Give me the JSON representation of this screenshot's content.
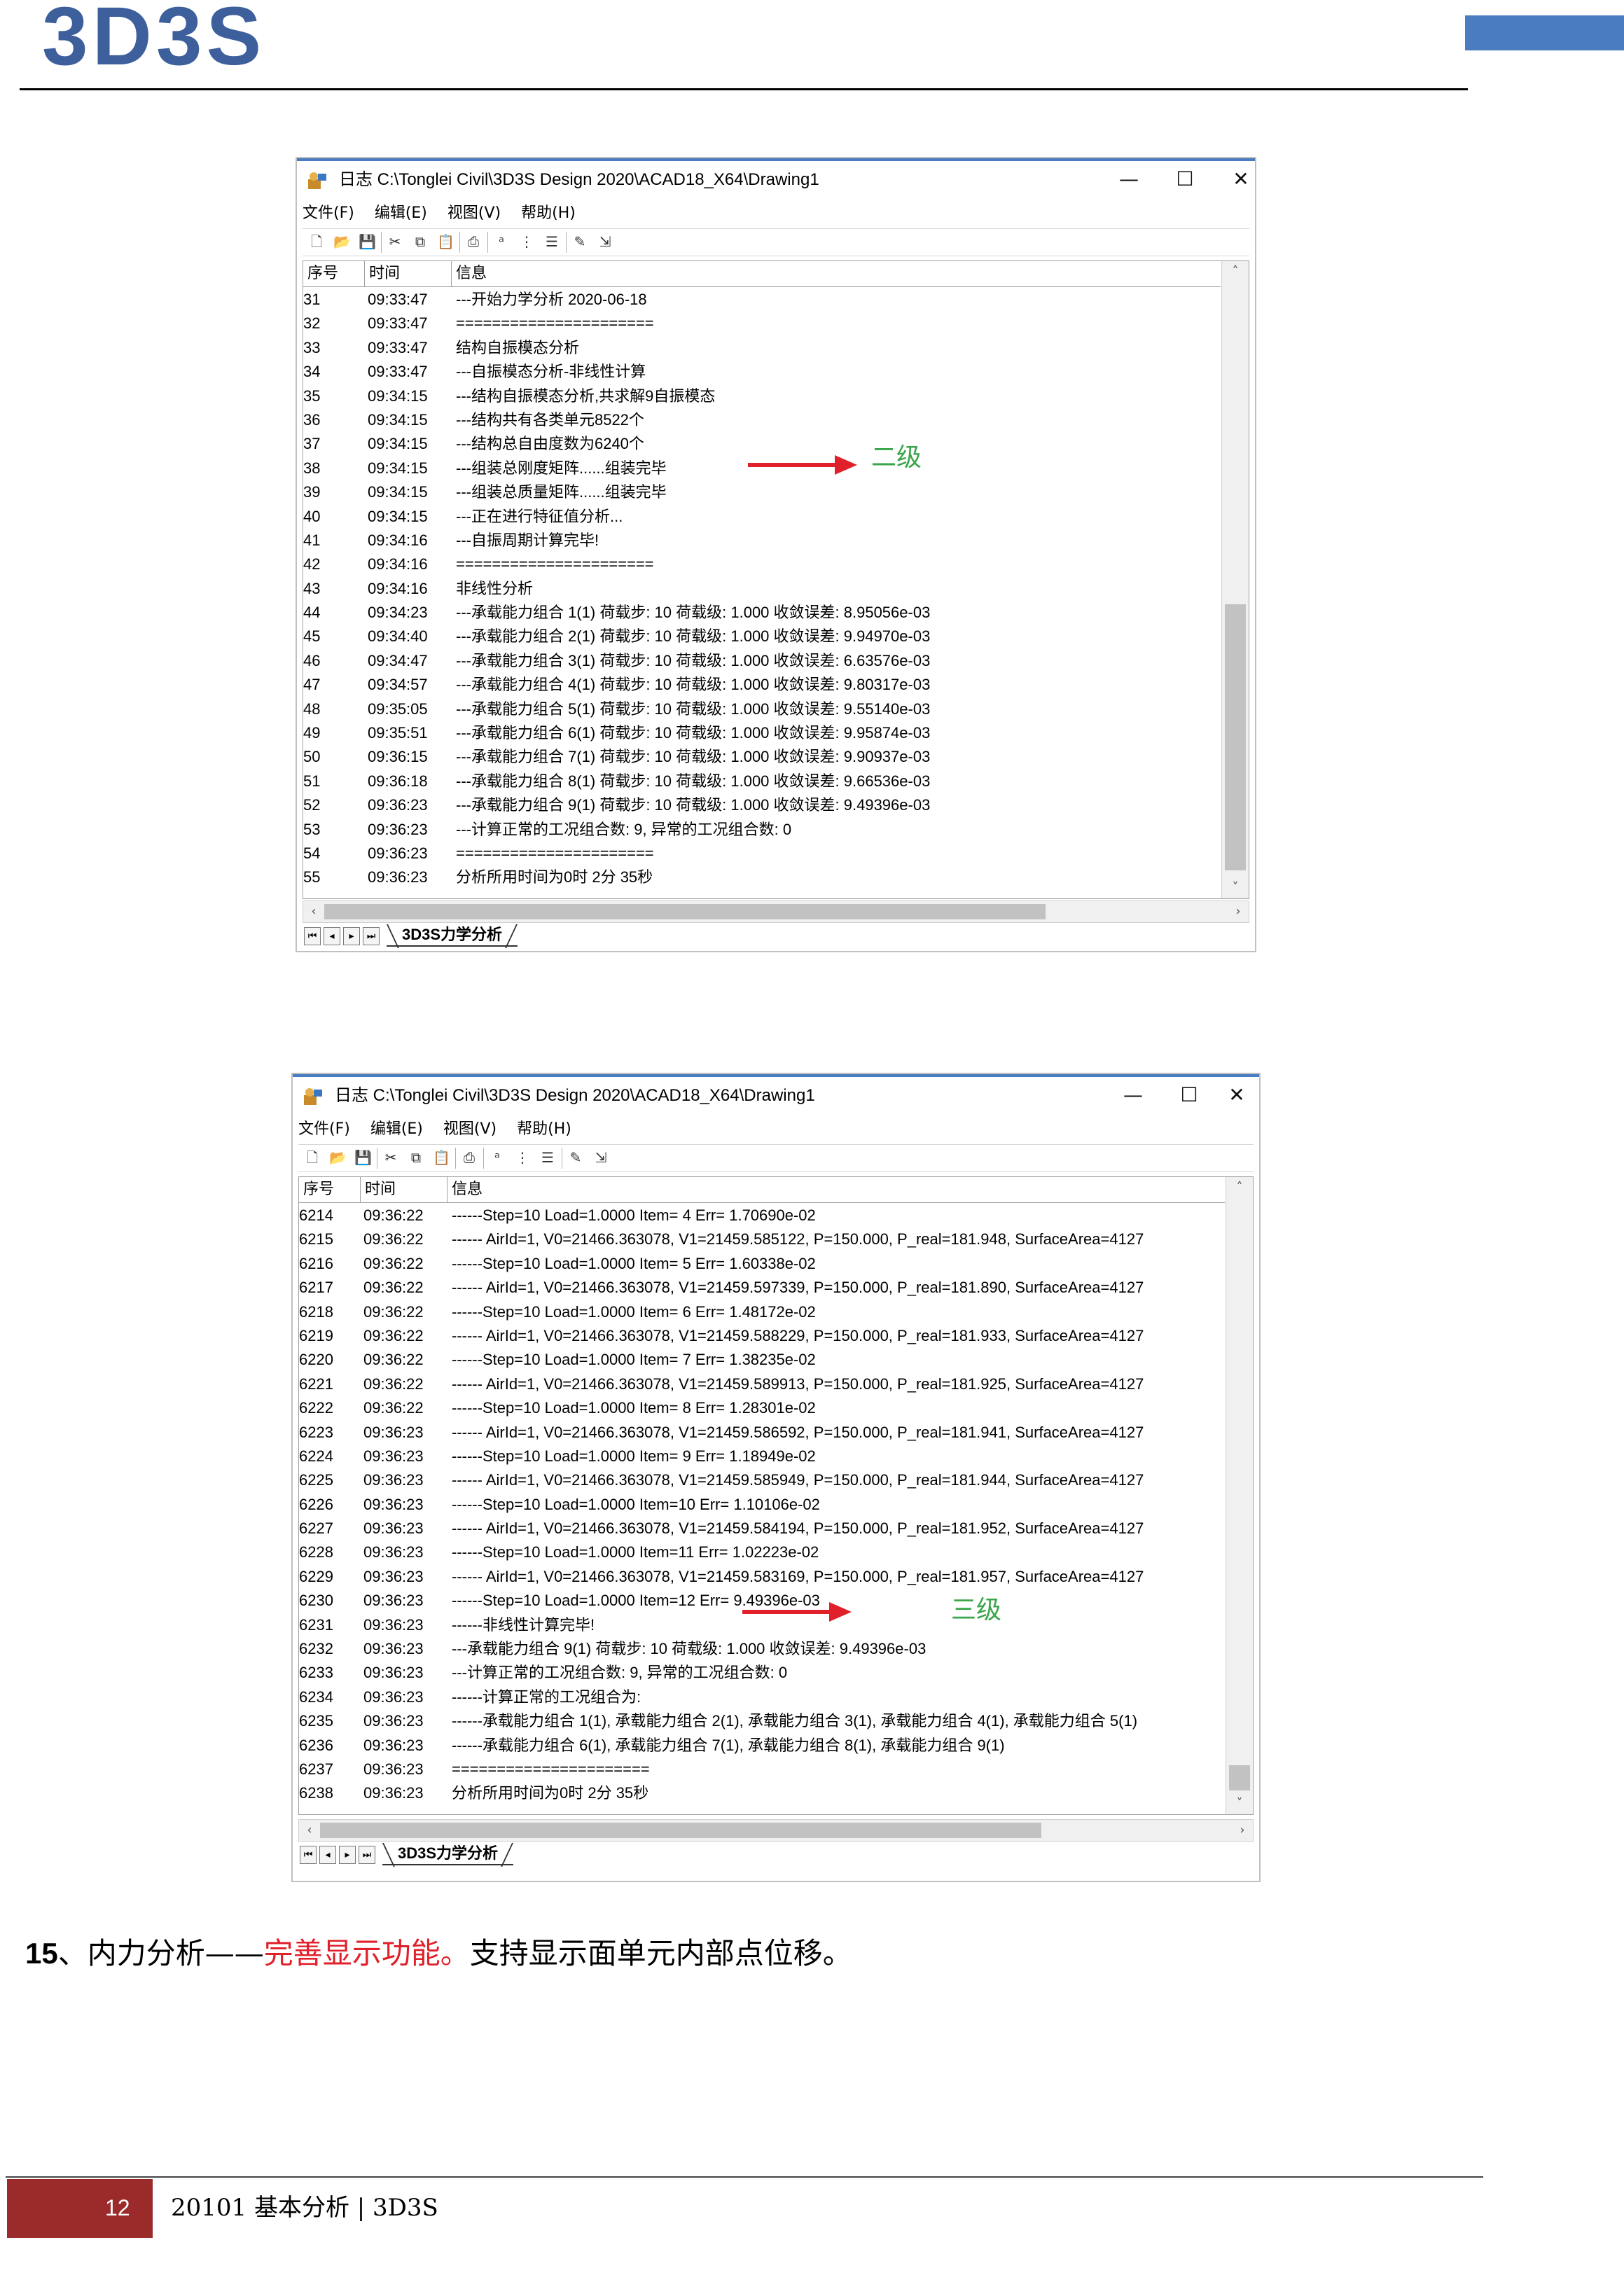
{
  "header": {
    "logo_text": "3D3S"
  },
  "windows": [
    {
      "title": "日志  C:\\Tonglei Civil\\3D3S Design 2020\\ACAD18_X64\\Drawing1",
      "menu": [
        "文件(F)",
        "编辑(E)",
        "视图(V)",
        "帮助(H)"
      ],
      "columns": [
        "序号",
        "时间",
        "信息"
      ],
      "rows": [
        {
          "n": "31",
          "t": "09:33:47",
          "m": "---开始力学分析    2020-06-18"
        },
        {
          "n": "32",
          "t": "09:33:47",
          "m": "======================"
        },
        {
          "n": "33",
          "t": "09:33:47",
          "m": "结构自振模态分析"
        },
        {
          "n": "34",
          "t": "09:33:47",
          "m": "---自振模态分析-非线性计算"
        },
        {
          "n": "35",
          "t": "09:34:15",
          "m": "---结构自振模态分析,共求解9自振模态"
        },
        {
          "n": "36",
          "t": "09:34:15",
          "m": "---结构共有各类单元8522个"
        },
        {
          "n": "37",
          "t": "09:34:15",
          "m": "---结构总自由度数为6240个"
        },
        {
          "n": "38",
          "t": "09:34:15",
          "m": "---组装总刚度矩阵......组装完毕"
        },
        {
          "n": "39",
          "t": "09:34:15",
          "m": "---组装总质量矩阵......组装完毕"
        },
        {
          "n": "40",
          "t": "09:34:15",
          "m": "---正在进行特征值分析..."
        },
        {
          "n": "41",
          "t": "09:34:16",
          "m": "---自振周期计算完毕!"
        },
        {
          "n": "42",
          "t": "09:34:16",
          "m": "======================"
        },
        {
          "n": "43",
          "t": "09:34:16",
          "m": "非线性分析"
        },
        {
          "n": "44",
          "t": "09:34:23",
          "m": "---承载能力组合 1(1)    荷载步: 10  荷载级: 1.000  收敛误差:  8.95056e-03"
        },
        {
          "n": "45",
          "t": "09:34:40",
          "m": "---承载能力组合 2(1)    荷载步: 10  荷载级: 1.000  收敛误差:  9.94970e-03"
        },
        {
          "n": "46",
          "t": "09:34:47",
          "m": "---承载能力组合 3(1)    荷载步: 10  荷载级: 1.000  收敛误差:  6.63576e-03"
        },
        {
          "n": "47",
          "t": "09:34:57",
          "m": "---承载能力组合 4(1)    荷载步: 10  荷载级: 1.000  收敛误差:  9.80317e-03"
        },
        {
          "n": "48",
          "t": "09:35:05",
          "m": "---承载能力组合 5(1)    荷载步: 10  荷载级: 1.000  收敛误差:  9.55140e-03"
        },
        {
          "n": "49",
          "t": "09:35:51",
          "m": "---承载能力组合 6(1)    荷载步: 10  荷载级: 1.000  收敛误差:  9.95874e-03"
        },
        {
          "n": "50",
          "t": "09:36:15",
          "m": "---承载能力组合 7(1)    荷载步: 10  荷载级: 1.000  收敛误差:  9.90937e-03"
        },
        {
          "n": "51",
          "t": "09:36:18",
          "m": "---承载能力组合 8(1)    荷载步: 10  荷载级: 1.000  收敛误差:  9.66536e-03"
        },
        {
          "n": "52",
          "t": "09:36:23",
          "m": "---承载能力组合 9(1)    荷载步: 10  荷载级: 1.000  收敛误差:  9.49396e-03"
        },
        {
          "n": "53",
          "t": "09:36:23",
          "m": "---计算正常的工况组合数: 9, 异常的工况组合数: 0"
        },
        {
          "n": "54",
          "t": "09:36:23",
          "m": "======================"
        },
        {
          "n": "55",
          "t": "09:36:23",
          "m": "分析所用时间为0时 2分 35秒"
        }
      ],
      "annotation": "二级",
      "sheet_tab": "3D3S力学分析"
    },
    {
      "title": "日志  C:\\Tonglei Civil\\3D3S Design 2020\\ACAD18_X64\\Drawing1",
      "menu": [
        "文件(F)",
        "编辑(E)",
        "视图(V)",
        "帮助(H)"
      ],
      "columns": [
        "序号",
        "时间",
        "信息"
      ],
      "rows": [
        {
          "n": "6214",
          "t": "09:36:22",
          "m": "------Step=10  Load=1.0000  Item= 4  Err= 1.70690e-02"
        },
        {
          "n": "6215",
          "t": "09:36:22",
          "m": "------ AirId=1, V0=21466.363078, V1=21459.585122, P=150.000, P_real=181.948, SurfaceArea=4127"
        },
        {
          "n": "6216",
          "t": "09:36:22",
          "m": "------Step=10  Load=1.0000  Item= 5  Err= 1.60338e-02"
        },
        {
          "n": "6217",
          "t": "09:36:22",
          "m": "------ AirId=1, V0=21466.363078, V1=21459.597339, P=150.000, P_real=181.890, SurfaceArea=4127"
        },
        {
          "n": "6218",
          "t": "09:36:22",
          "m": "------Step=10  Load=1.0000  Item= 6  Err= 1.48172e-02"
        },
        {
          "n": "6219",
          "t": "09:36:22",
          "m": "------ AirId=1, V0=21466.363078, V1=21459.588229, P=150.000, P_real=181.933, SurfaceArea=4127"
        },
        {
          "n": "6220",
          "t": "09:36:22",
          "m": "------Step=10  Load=1.0000  Item= 7  Err= 1.38235e-02"
        },
        {
          "n": "6221",
          "t": "09:36:22",
          "m": "------ AirId=1, V0=21466.363078, V1=21459.589913, P=150.000, P_real=181.925, SurfaceArea=4127"
        },
        {
          "n": "6222",
          "t": "09:36:22",
          "m": "------Step=10  Load=1.0000  Item= 8  Err= 1.28301e-02"
        },
        {
          "n": "6223",
          "t": "09:36:23",
          "m": "------ AirId=1, V0=21466.363078, V1=21459.586592, P=150.000, P_real=181.941, SurfaceArea=4127"
        },
        {
          "n": "6224",
          "t": "09:36:23",
          "m": "------Step=10  Load=1.0000  Item= 9  Err= 1.18949e-02"
        },
        {
          "n": "6225",
          "t": "09:36:23",
          "m": "------ AirId=1, V0=21466.363078, V1=21459.585949, P=150.000, P_real=181.944, SurfaceArea=4127"
        },
        {
          "n": "6226",
          "t": "09:36:23",
          "m": "------Step=10  Load=1.0000  Item=10  Err= 1.10106e-02"
        },
        {
          "n": "6227",
          "t": "09:36:23",
          "m": "------ AirId=1, V0=21466.363078, V1=21459.584194, P=150.000, P_real=181.952, SurfaceArea=4127"
        },
        {
          "n": "6228",
          "t": "09:36:23",
          "m": "------Step=10  Load=1.0000  Item=11  Err= 1.02223e-02"
        },
        {
          "n": "6229",
          "t": "09:36:23",
          "m": "------ AirId=1, V0=21466.363078, V1=21459.583169, P=150.000, P_real=181.957, SurfaceArea=4127"
        },
        {
          "n": "6230",
          "t": "09:36:23",
          "m": "------Step=10  Load=1.0000  Item=12  Err= 9.49396e-03"
        },
        {
          "n": "6231",
          "t": "09:36:23",
          "m": "------非线性计算完毕!"
        },
        {
          "n": "6232",
          "t": "09:36:23",
          "m": "---承载能力组合 9(1)    荷载步: 10  荷载级: 1.000  收敛误差:  9.49396e-03"
        },
        {
          "n": "6233",
          "t": "09:36:23",
          "m": "---计算正常的工况组合数: 9, 异常的工况组合数: 0"
        },
        {
          "n": "6234",
          "t": "09:36:23",
          "m": "------计算正常的工况组合为:"
        },
        {
          "n": "6235",
          "t": "09:36:23",
          "m": "------承载能力组合 1(1), 承载能力组合 2(1), 承载能力组合 3(1), 承载能力组合 4(1), 承载能力组合 5(1)"
        },
        {
          "n": "6236",
          "t": "09:36:23",
          "m": "------承载能力组合 6(1), 承载能力组合 7(1), 承载能力组合 8(1), 承载能力组合 9(1)"
        },
        {
          "n": "6237",
          "t": "09:36:23",
          "m": "======================"
        },
        {
          "n": "6238",
          "t": "09:36:23",
          "m": "分析所用时间为0时 2分 35秒"
        }
      ],
      "annotation": "三级",
      "sheet_tab": "3D3S力学分析"
    }
  ],
  "paragraph": {
    "number": "15",
    "sep": "、内力分析——",
    "highlight": "完善显示功能。",
    "rest": "支持显示面单元内部点位移。",
    "highlight_color": "#e0202a"
  },
  "footer": {
    "page": "12",
    "text": "20101  基本分析  | 3D3S"
  },
  "colors": {
    "brand": "#3d5f9c",
    "footer_box": "#9b2a2a",
    "arrow": "#e0202a",
    "annotation": "#3aa64a"
  }
}
